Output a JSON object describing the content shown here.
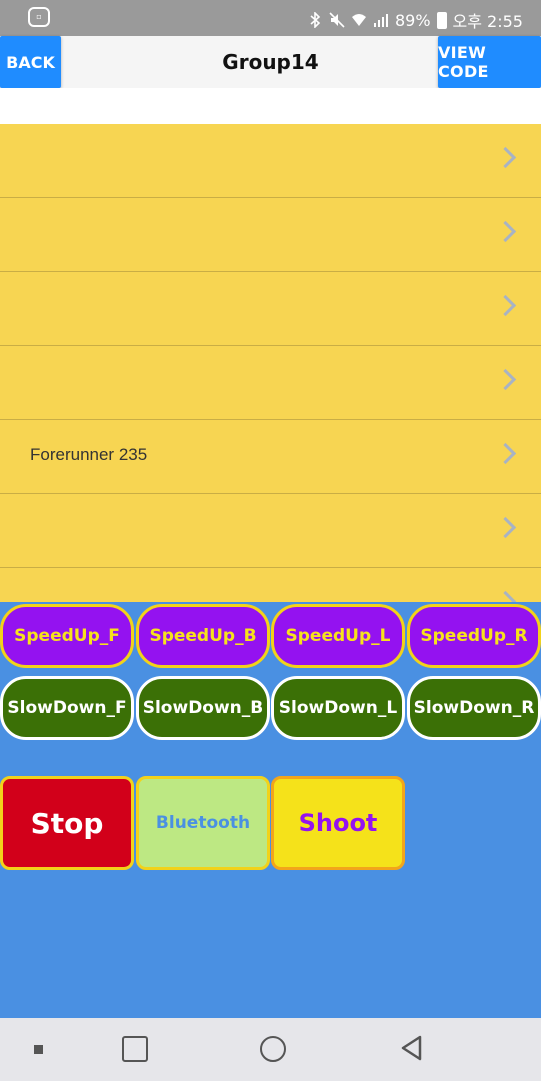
{
  "status": {
    "battery": "89%",
    "time": "오후 2:55"
  },
  "header": {
    "back_label": "BACK",
    "title": "Group14",
    "viewcode_label": "VIEW CODE"
  },
  "list": {
    "items": [
      {
        "label": ""
      },
      {
        "label": ""
      },
      {
        "label": ""
      },
      {
        "label": ""
      },
      {
        "label": "Forerunner 235"
      },
      {
        "label": ""
      },
      {
        "label": ""
      }
    ]
  },
  "controls": {
    "speed_buttons": [
      "SpeedUp_F",
      "SpeedUp_B",
      "SpeedUp_L",
      "SpeedUp_R"
    ],
    "slow_buttons": [
      "SlowDown_F",
      "SlowDown_B",
      "SlowDown_L",
      "SlowDown_R"
    ],
    "stop_label": "Stop",
    "bluetooth_label": "Bluetooth",
    "shoot_label": "Shoot"
  },
  "colors": {
    "accent_blue": "#1f8cff",
    "list_yellow": "#f7d552",
    "panel_blue": "#4a90e2",
    "speed_purple": "#9412f0",
    "slow_green": "#3b7006",
    "stop_red": "#d2001a"
  }
}
